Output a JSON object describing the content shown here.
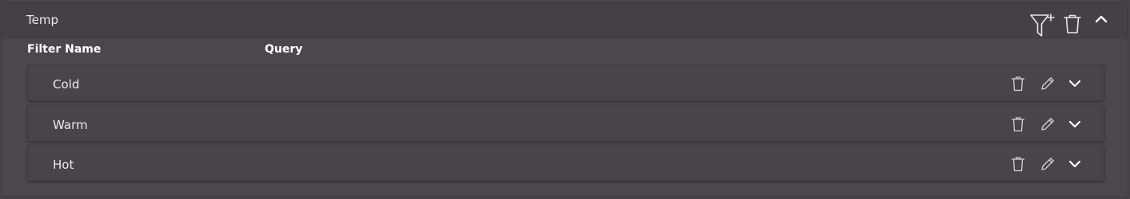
{
  "panel": {
    "title": "Temp"
  },
  "header_icons": [
    "add-filter-icon",
    "trash-icon",
    "chevron-up-icon"
  ],
  "columns": {
    "filter_name": "Filter Name",
    "query": "Query"
  },
  "rows": [
    {
      "label": "Cold",
      "icons": [
        "trash-icon",
        "pencil-icon",
        "chevron-down-icon"
      ]
    },
    {
      "label": "Warm",
      "icons": [
        "trash-icon",
        "pencil-icon",
        "chevron-down-icon"
      ]
    },
    {
      "label": "Hot",
      "icons": [
        "trash-icon",
        "pencil-icon",
        "chevron-down-icon"
      ]
    }
  ]
}
